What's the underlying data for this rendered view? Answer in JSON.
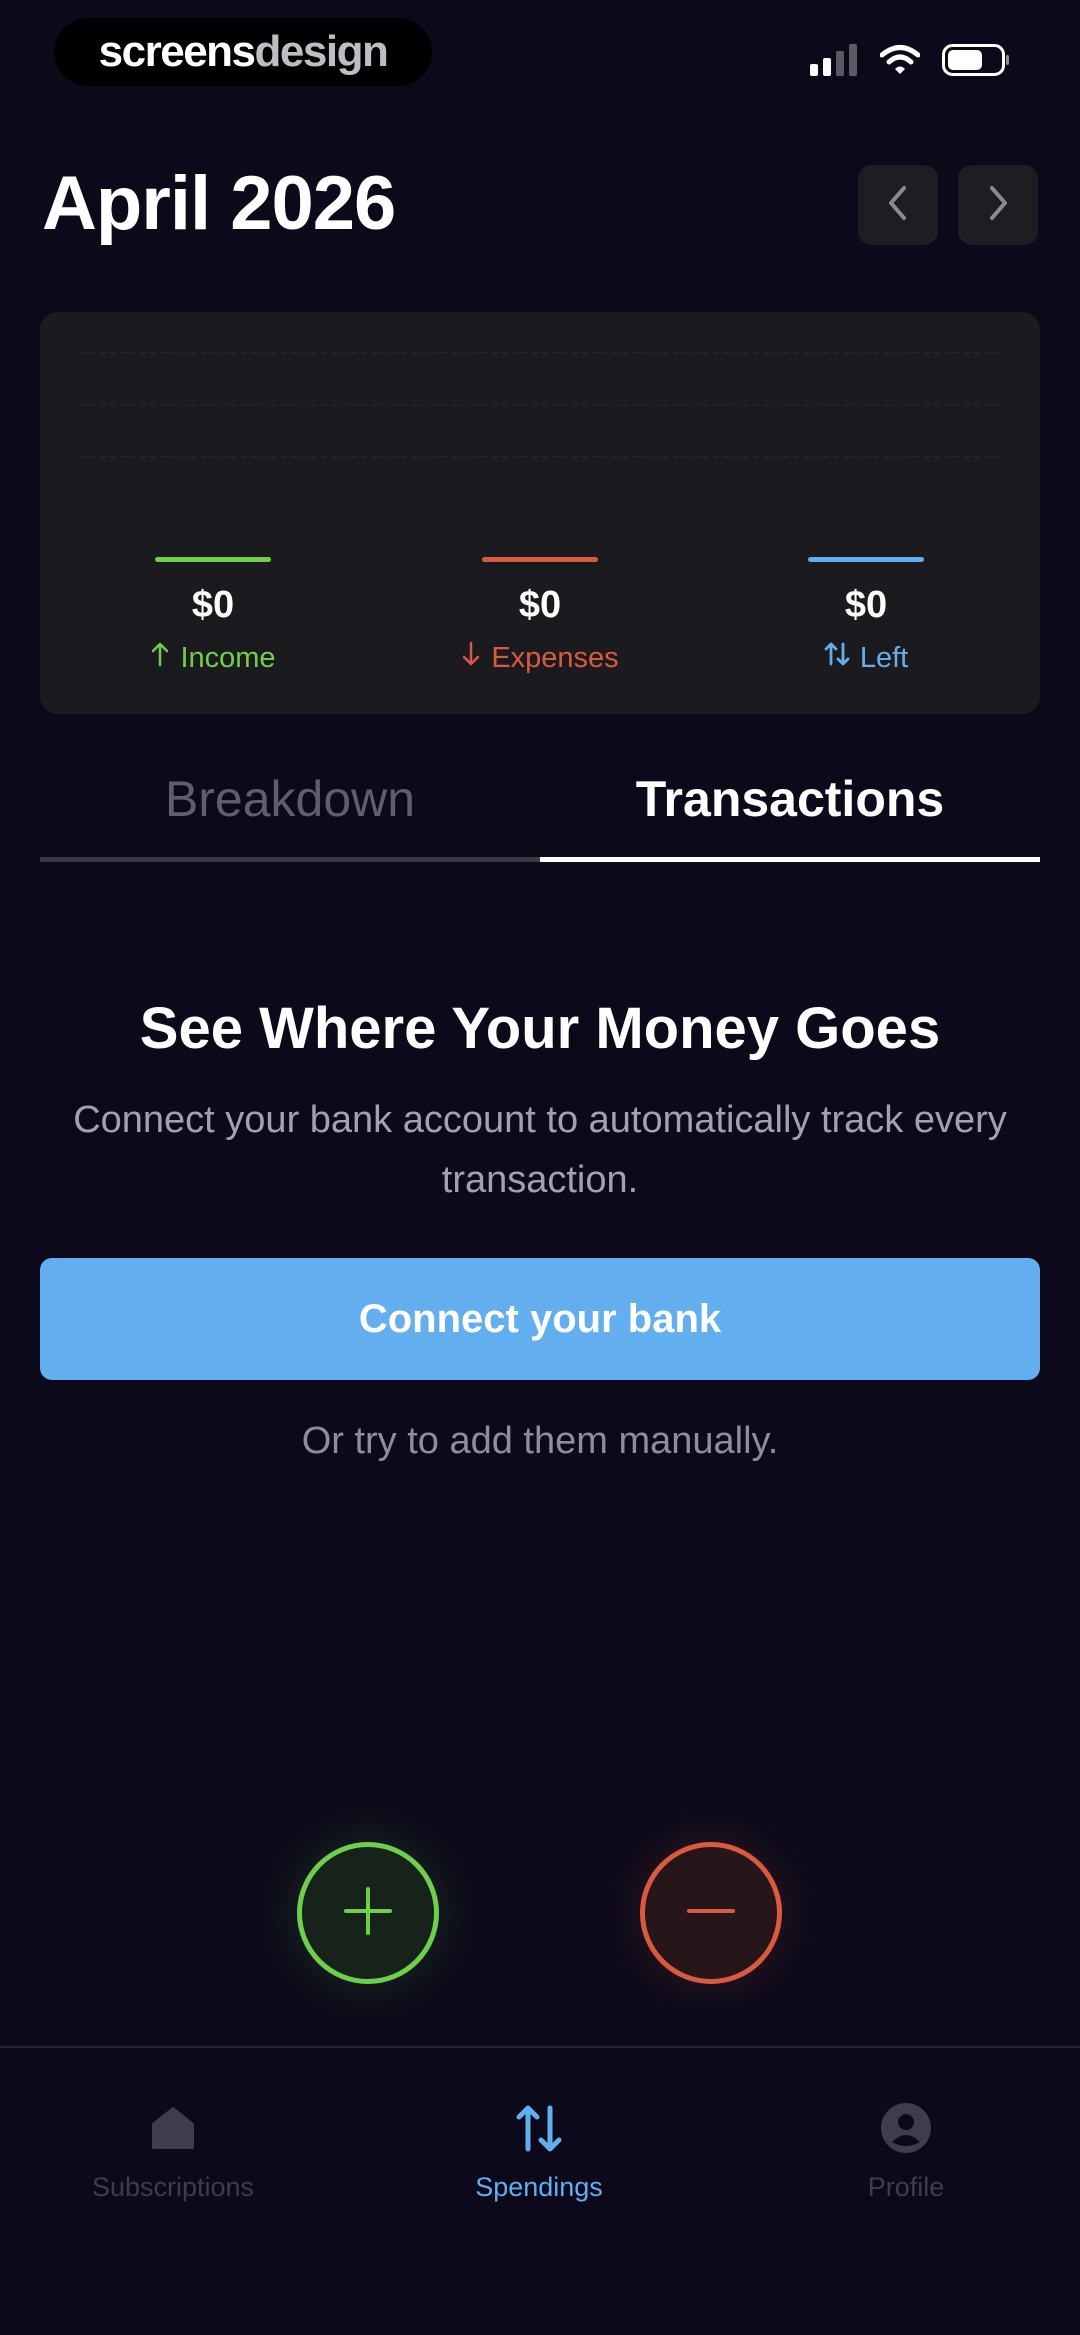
{
  "brand": {
    "part1": "screens",
    "part2": "design"
  },
  "header": {
    "month": "April 2026"
  },
  "summary": {
    "income": {
      "value": "$0",
      "label": "Income",
      "color": "#6fcf4b"
    },
    "expenses": {
      "value": "$0",
      "label": "Expenses",
      "color": "#d95a3f"
    },
    "left": {
      "value": "$0",
      "label": "Left",
      "color": "#63aeee"
    }
  },
  "tabs": {
    "breakdown": "Breakdown",
    "transactions": "Transactions",
    "active": "Transactions"
  },
  "empty_state": {
    "title": "See Where Your Money Goes",
    "text": "Connect your bank account to automatically track every transaction.",
    "button": "Connect your bank",
    "manual": "Or try to add them manually."
  },
  "bottom_nav": {
    "subscriptions": "Subscriptions",
    "spendings": "Spendings",
    "profile": "Profile",
    "active": "Spendings"
  },
  "icons": {
    "signal": "signal-icon",
    "wifi": "wifi-icon",
    "battery": "battery-icon",
    "prev": "chevron-left-icon",
    "next": "chevron-right-icon",
    "add": "plus-icon",
    "subtract": "minus-icon",
    "home": "home-icon",
    "transfer": "arrows-up-down-icon",
    "profile": "user-icon"
  },
  "colors": {
    "accent": "#63aeee",
    "background": "#0c0a1a",
    "card": "#1b1b1f"
  }
}
